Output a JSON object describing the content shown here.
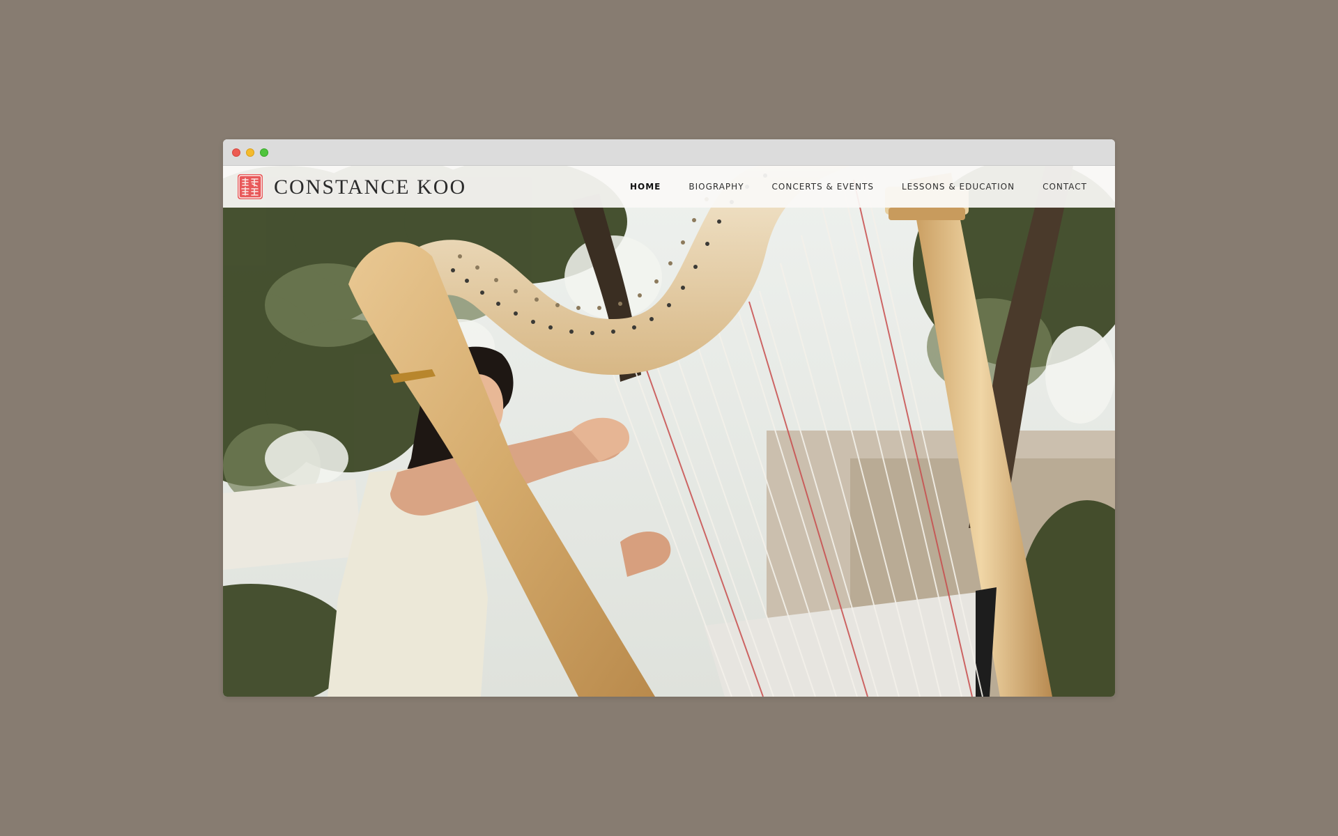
{
  "site": {
    "title": "CONSTANCE KOO"
  },
  "nav": {
    "items": [
      {
        "label": "HOME",
        "active": true
      },
      {
        "label": "BIOGRAPHY",
        "active": false
      },
      {
        "label": "CONCERTS & EVENTS",
        "active": false
      },
      {
        "label": "LESSONS & EDUCATION",
        "active": false
      },
      {
        "label": "CONTACT",
        "active": false
      }
    ]
  },
  "colors": {
    "background": "#877c71",
    "titlebar": "#dcdcdc",
    "close": "#ec5b52",
    "minimize": "#f4bb2e",
    "maximize": "#4fc43d",
    "seal": "#e8595a",
    "harp_wood": "#d9b27a",
    "foliage": "#3f4a2a"
  },
  "icons": {
    "close": "close-dot-icon",
    "minimize": "minimize-dot-icon",
    "maximize": "maximize-dot-icon",
    "logo": "chinese-seal-logo-icon"
  },
  "hero": {
    "description_icon": "harpist-photo-image"
  }
}
